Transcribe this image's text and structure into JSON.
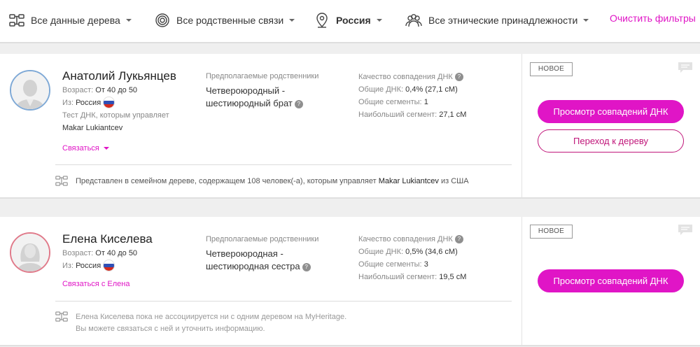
{
  "filters": {
    "tree_data": "Все данные дерева",
    "relations": "Все родственные связи",
    "location": "Россия",
    "ethnicity": "Все этнические принадлежности",
    "clear": "Очистить фильтры"
  },
  "matches": [
    {
      "name": "Анатолий Лукьянцев",
      "age_label": "Возраст:",
      "age": "От 40 до 50",
      "from_label": "Из:",
      "from": "Россия",
      "managed_label": "Тест ДНК, которым управляет",
      "manager": "Makar Lukiantcev",
      "contact": "Связаться",
      "relation_label": "Предполагаемые родственники",
      "relation_line1": "Четвероюродный -",
      "relation_line2": "шестиюродный брат",
      "quality_label": "Качество совпадения ДНК",
      "shared_dna_label": "Общие ДНК:",
      "shared_dna": "0,4% (27,1 сМ)",
      "segments_label": "Общие сегменты:",
      "segments": "1",
      "largest_label": "Наибольший сегмент:",
      "largest": "27,1 сМ",
      "tree_text_pre": "Представлен в семейном дереве, содержащем 108 человек(-а), которым управляет",
      "tree_manager": "Makar Lukiantcev",
      "tree_text_post": "из США",
      "badge": "НОВОЕ",
      "btn_review": "Просмотр совпадений ДНК",
      "btn_tree": "Переход к дереву"
    },
    {
      "name": "Елена Киселева",
      "age_label": "Возраст:",
      "age": "От 40 до 50",
      "from_label": "Из:",
      "from": "Россия",
      "contact": "Связаться с Елена",
      "relation_label": "Предполагаемые родственники",
      "relation_line1": "Четвероюродная -",
      "relation_line2": "шестиюродная сестра",
      "quality_label": "Качество совпадения ДНК",
      "shared_dna_label": "Общие ДНК:",
      "shared_dna": "0,5% (34,6 сМ)",
      "segments_label": "Общие сегменты:",
      "segments": "3",
      "largest_label": "Наибольший сегмент:",
      "largest": "19,5 сМ",
      "tree_line1": "Елена Киселева пока не ассоциируется ни с одним деревом на MyHeritage.",
      "tree_line2": "Вы можете связаться с ней и уточнить информацию.",
      "badge": "НОВОЕ",
      "btn_review": "Просмотр совпадений ДНК"
    }
  ],
  "help_glyph": "?",
  "colors": {
    "accent": "#e015c6",
    "outline": "#c0167a"
  }
}
